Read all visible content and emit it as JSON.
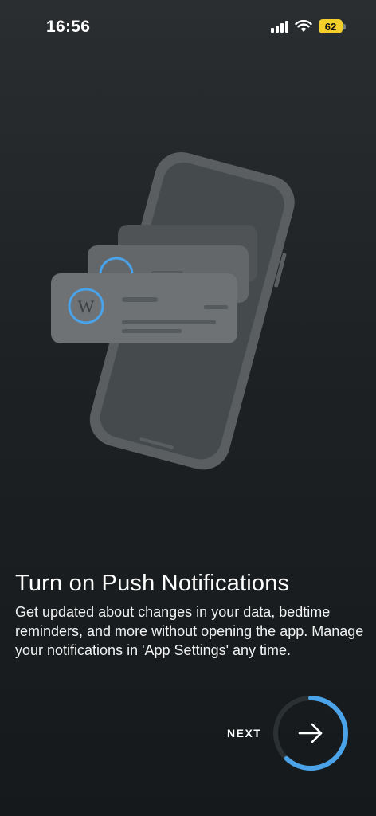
{
  "status_bar": {
    "time": "16:56",
    "battery_level": "62",
    "battery_color": "#f4cf2a"
  },
  "illustration": {
    "logo_text": "W",
    "accent_color": "#4aa3e8"
  },
  "onboarding": {
    "title": "Turn on Push Notifications",
    "description": "Get updated about changes in your data, bedtime reminders, and more without opening the app. Manage your notifications in 'App Settings' any time.",
    "next_label": "NEXT",
    "progress_fraction": 0.62
  }
}
